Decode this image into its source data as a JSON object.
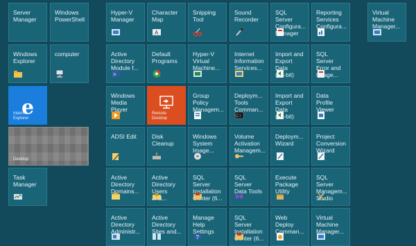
{
  "tiles": {
    "server_manager": "Server\nManager",
    "windows_powershell": "Windows\nPowerShell",
    "windows_explorer": "Windows\nExplorer",
    "computer": "computer",
    "internet_explorer": "Internet Explorer",
    "desktop": "Desktop",
    "task_manager": "Task\nManager",
    "hyperv_manager": "Hyper-V\nManager",
    "character_map": "Character\nMap",
    "snipping_tool": "Snipping\nTool",
    "sound_recorder": "Sound\nRecorder",
    "sql_config_manager": "SQL Server\nConfigura...\nManager",
    "reporting_services": "Reporting\nServices\nConfigura...",
    "virtual_machine_manager_top": "Virtual\nMachine\nManager...",
    "ad_module_powershell": "Active\nDirectory\nModule f...",
    "default_programs": "Default\nPrograms",
    "hyperv_vm_connection": "Hyper-V\nVirtual\nMachine...",
    "iis_manager": "Internet\nInformation\nServices...",
    "import_export_64": "Import and\nExport Data\n(64-bit)",
    "sql_error_usage": "SQL Server\nError and\nUsage...",
    "windows_media_player": "Windows\nMedia\nPlayer",
    "remote_desktop": "Remote Desktop",
    "group_policy_mgmt": "Group\nPolicy\nManagem...",
    "deployment_tools_cmd": "Deploym...\nTools\nComman...",
    "import_export_32": "Import and\nExport Data\n(32-bit)",
    "data_profile_viewer": "Data Profile\nViewer",
    "adsi_edit": "ADSI Edit",
    "disk_cleanup": "Disk\nCleanup",
    "windows_system_image": "Windows\nSystem\nImage...",
    "volume_activation": "Volume\nActivation\nManagem...",
    "deployment_wizard": "Deploym...\nWizard",
    "project_conversion": "Project\nConversion\nWizard",
    "ad_domains": "Active\nDirectory\nDomains...",
    "ad_users": "Active\nDirectory\nUsers and...",
    "sql_install_center_1": "SQL Server\nInstallation\nCenter (6...",
    "sql_data_tools": "SQL Server\nData Tools",
    "execute_package": "Execute\nPackage\nUtility",
    "sql_mgmt_studio": "SQL Server\nManagem...\nStudio",
    "ad_admin": "Active\nDirectory\nAdministr...",
    "ad_sites": "Active\nDirectory\nSites and...",
    "manage_help": "Manage\nHelp\nSettings",
    "sql_install_center_2": "SQL Server\nInstallation\nCenter (6...",
    "web_deploy": "Web\nDeploy\nComman...",
    "virtual_machine_manager_bottom": "Virtual\nMachine\nManager..."
  }
}
